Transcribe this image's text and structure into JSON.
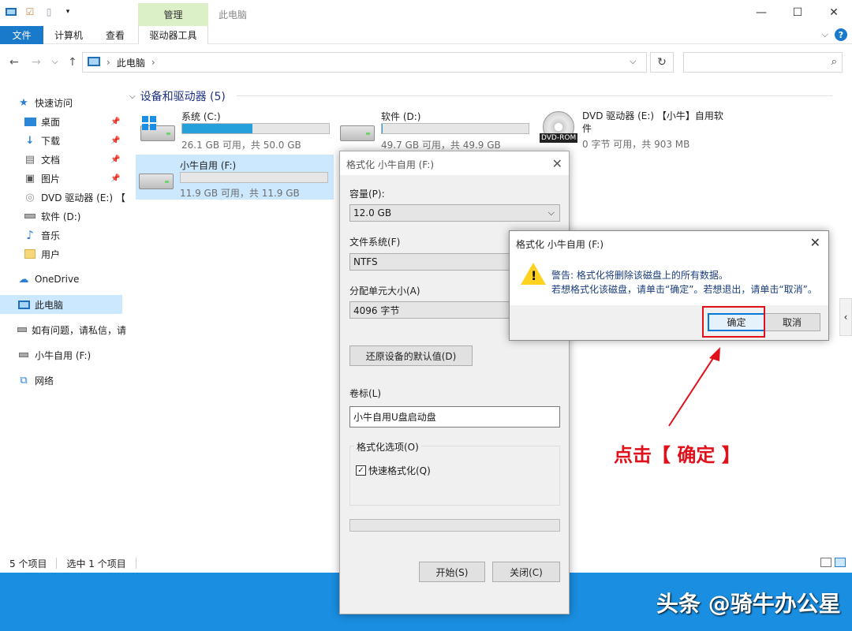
{
  "window": {
    "title": "此电脑",
    "context_tab": "管理",
    "controls": {
      "minimize": "—",
      "maximize": "☐",
      "close": "✕"
    }
  },
  "ribbon": {
    "tabs": [
      "文件",
      "计算机",
      "查看"
    ],
    "context_subtab": "驱动器工具",
    "expand": "⌵",
    "help": "?"
  },
  "address": {
    "back": "←",
    "forward": "→",
    "recent": "⌵",
    "up": "↑",
    "path": "此电脑",
    "separator": "›",
    "dropdown": "⌵",
    "refresh": "↻",
    "search_icon": "⌕"
  },
  "sidebar": {
    "quick_access": "快速访问",
    "items": [
      {
        "label": "桌面",
        "pinned": true
      },
      {
        "label": "下载",
        "pinned": true
      },
      {
        "label": "文档",
        "pinned": true
      },
      {
        "label": "图片",
        "pinned": true
      },
      {
        "label": "DVD 驱动器 (E:) 【",
        "pinned": false
      },
      {
        "label": "软件 (D:)",
        "pinned": false
      },
      {
        "label": "音乐",
        "pinned": false
      },
      {
        "label": "用户",
        "pinned": false
      }
    ],
    "onedrive": "OneDrive",
    "this_pc": "此电脑",
    "help_link": "如有问题，请私信，请",
    "usb": "小牛自用 (F:)",
    "network": "网络"
  },
  "main": {
    "group_title": "设备和驱动器 (5)",
    "drives": [
      {
        "name": "系统 (C:)",
        "size_text": "26.1 GB 可用，共 50.0 GB",
        "used_fraction": 0.478
      },
      {
        "name": "软件 (D:)",
        "size_text": "49.7 GB 可用，共 49.9 GB",
        "used_fraction": 0.004
      },
      {
        "name": "DVD 驱动器 (E:) 【小牛】自用软件",
        "size_text": "0 字节 可用，共 903 MB",
        "icon_label": "DVD-ROM"
      },
      {
        "name": "小牛自用 (F:)",
        "size_text": "11.9 GB 可用，共 11.9 GB",
        "used_fraction": 0.0
      }
    ]
  },
  "status": {
    "item_count": "5 个项目",
    "selected": "选中 1 个项目"
  },
  "format_dialog": {
    "title": "格式化 小牛自用 (F:)",
    "capacity_label": "容量(P):",
    "capacity_value": "12.0 GB",
    "fs_label": "文件系统(F)",
    "fs_value": "NTFS",
    "alloc_label": "分配单元大小(A)",
    "alloc_value": "4096 字节",
    "restore_btn": "还原设备的默认值(D)",
    "volume_label": "卷标(L)",
    "volume_value": "小牛自用U盘启动盘",
    "options_label": "格式化选项(O)",
    "quick_format": "快速格式化(Q)",
    "start_btn": "开始(S)",
    "close_btn": "关闭(C)"
  },
  "warning_dialog": {
    "title": "格式化 小牛自用 (F:)",
    "line1": "警告: 格式化将删除该磁盘上的所有数据。",
    "line2": "若想格式化该磁盘，请单击“确定”。若想退出，请单击“取消”。",
    "ok": "确定",
    "cancel": "取消"
  },
  "annotation": {
    "text": "点击【 确定 】"
  },
  "watermark": "头条 @骑牛办公星",
  "colors": {
    "accent": "#1979ca",
    "highlight": "#e0111a",
    "selection": "#cce8ff",
    "context_tab": "#dcf0c8",
    "drive_bar": "#26a0da",
    "desktop": "#1a8ee0"
  }
}
